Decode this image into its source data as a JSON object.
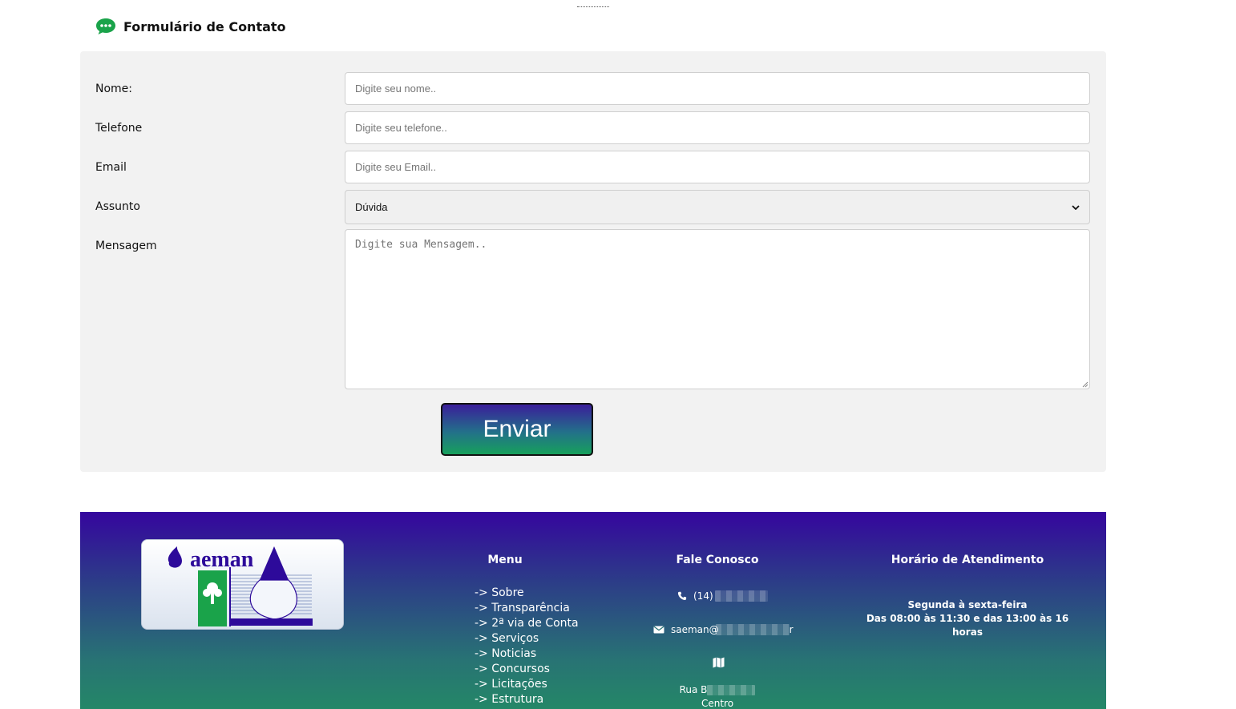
{
  "form": {
    "title": "Formulário de Contato",
    "fields": {
      "name": {
        "label": "Nome:",
        "placeholder": "Digite seu nome.."
      },
      "phone": {
        "label": "Telefone",
        "placeholder": "Digite seu telefone.."
      },
      "email": {
        "label": "Email",
        "placeholder": "Digite seu Email.."
      },
      "subject": {
        "label": "Assunto",
        "selected": "Dúvida"
      },
      "message": {
        "label": "Mensagem",
        "placeholder": "Digite sua Mensagem.."
      }
    },
    "submit_label": "Enviar"
  },
  "footer": {
    "logo_text": "aeman",
    "menu": {
      "title": "Menu",
      "items": [
        "-> Sobre",
        "-> Transparência",
        "-> 2ª via de Conta",
        "-> Serviços",
        "-> Noticias",
        "-> Concursos",
        "-> Licitações",
        "-> Estrutura"
      ]
    },
    "contact": {
      "title": "Fale Conosco",
      "phone_prefix": "(14)",
      "email_prefix": "saeman@",
      "email_suffix": "r",
      "address_prefix": "Rua B",
      "address_district": "Centro"
    },
    "hours": {
      "title": "Horário de Atendimento",
      "days": "Segunda à sexta-feira",
      "times": "Das 08:00 às 11:30 e das 13:00 às 16 horas"
    }
  },
  "colors": {
    "icon_green": "#1aa34a",
    "button_top": "#3a1e9a",
    "button_bottom": "#17a05c",
    "footer_top": "#35069e",
    "footer_bottom": "#248767",
    "panel_bg": "#f2f2f2"
  }
}
